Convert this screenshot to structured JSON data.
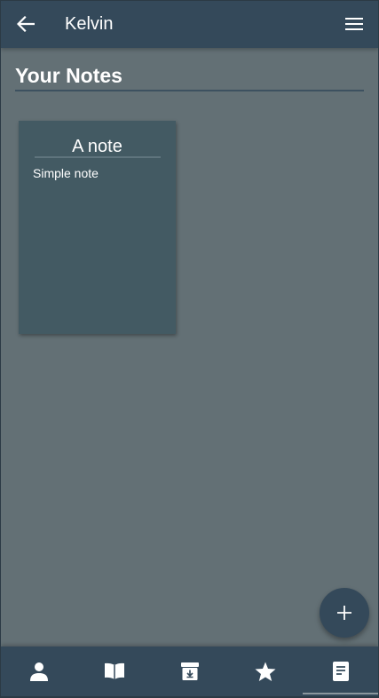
{
  "app_bar": {
    "title": "Kelvin",
    "back_icon": "arrow-left-icon",
    "menu_icon": "hamburger-menu-icon"
  },
  "section": {
    "title": "Your Notes"
  },
  "notes": [
    {
      "title": "A note",
      "body": "Simple note"
    }
  ],
  "fab": {
    "icon": "plus-icon"
  },
  "bottom_nav": {
    "items": [
      {
        "icon": "person-icon",
        "active": false
      },
      {
        "icon": "open-book-icon",
        "active": false
      },
      {
        "icon": "archive-icon",
        "active": false
      },
      {
        "icon": "star-icon",
        "active": false
      },
      {
        "icon": "note-icon",
        "active": true
      }
    ]
  },
  "colors": {
    "app_bar": "#34495a",
    "background": "#637075",
    "card": "#435a63",
    "text": "#ffffff"
  }
}
